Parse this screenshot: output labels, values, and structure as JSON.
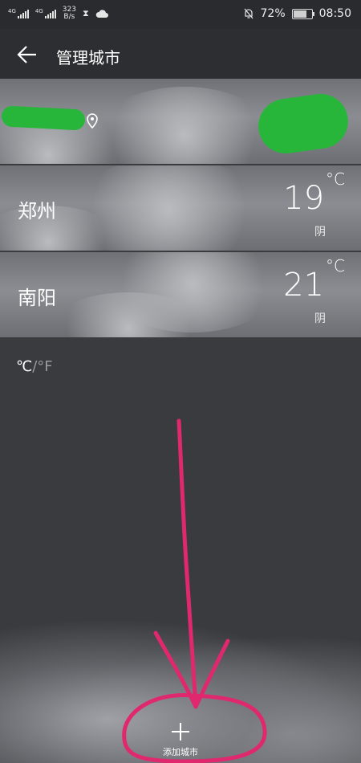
{
  "status_bar": {
    "sim1_label": "4G",
    "sim2_label": "4G",
    "net_speed_value": "323",
    "net_speed_unit": "B/s",
    "battery_percent": "72%",
    "battery_level": 0.72,
    "time": "08:50"
  },
  "header": {
    "title": "管理城市"
  },
  "cities": [
    {
      "name": "",
      "temp": "",
      "condition": ""
    },
    {
      "name": "郑州",
      "temp": "19",
      "unit": "°C",
      "condition": "阴"
    },
    {
      "name": "南阳",
      "temp": "21",
      "unit": "°C",
      "condition": "阴"
    }
  ],
  "unit_toggle": {
    "celsius": "℃",
    "separator": "/",
    "fahrenheit": "°F"
  },
  "add_city": {
    "label": "添加城市"
  },
  "colors": {
    "annotation": "#e0286f",
    "redaction": "#27b53a"
  }
}
